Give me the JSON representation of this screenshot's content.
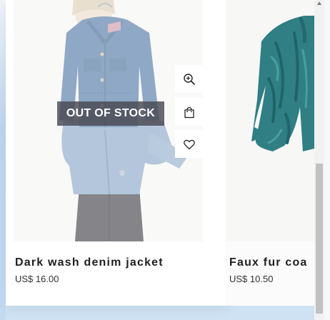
{
  "products": [
    {
      "name": "Dark wash denim jacket",
      "price": "US$ 16.00",
      "badge": "OUT OF STOCK",
      "actions": {
        "zoom_icon": "zoom-in-icon",
        "bag_icon": "shopping-bag-icon",
        "wishlist_icon": "heart-icon"
      },
      "image_subject": "denim jacket"
    },
    {
      "name": "Faux fur coa",
      "price": "US$ 10.50",
      "image_subject": "teal faux fur coat"
    }
  ],
  "colors": {
    "badge_bg": "#4a4a52",
    "badge_text": "#ffffff",
    "name_text": "#1f1f1f",
    "price_text": "#333333",
    "fur_teal": "#2f7f84",
    "denim": "#3f6a9c"
  }
}
